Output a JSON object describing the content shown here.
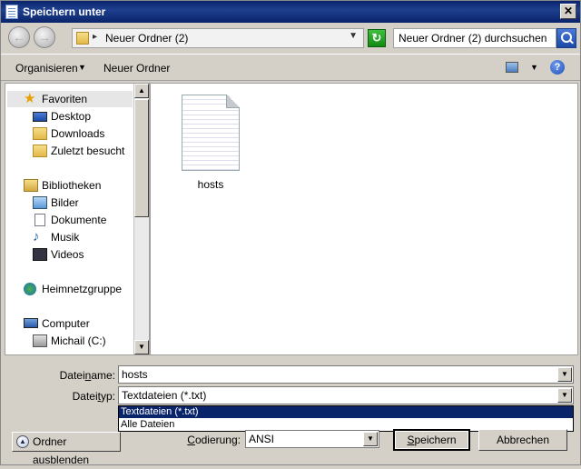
{
  "window": {
    "title": "Speichern unter",
    "close_symbol": "✕"
  },
  "nav": {
    "back_symbol": "←",
    "forward_symbol": "→",
    "address_path": "Neuer Ordner (2)",
    "refresh_symbol": "↻",
    "search_placeholder": "Neuer Ordner (2) durchsuchen"
  },
  "toolbar": {
    "organize_label": "Organisieren",
    "new_folder_label": "Neuer Ordner",
    "help_symbol": "?"
  },
  "sidebar": {
    "items": [
      {
        "label": "Favoriten",
        "icon": "star-icon"
      },
      {
        "label": "Desktop",
        "icon": "desktop-icon"
      },
      {
        "label": "Downloads",
        "icon": "downloads-folder-icon"
      },
      {
        "label": "Zuletzt besucht",
        "icon": "recent-places-icon"
      },
      {
        "label": "Bibliotheken",
        "icon": "libraries-icon"
      },
      {
        "label": "Bilder",
        "icon": "pictures-icon"
      },
      {
        "label": "Dokumente",
        "icon": "documents-icon"
      },
      {
        "label": "Musik",
        "icon": "music-icon"
      },
      {
        "label": "Videos",
        "icon": "videos-icon"
      },
      {
        "label": "Heimnetzgruppe",
        "icon": "homegroup-icon"
      },
      {
        "label": "Computer",
        "icon": "computer-icon"
      },
      {
        "label": "Michail (C:)",
        "icon": "drive-icon"
      }
    ]
  },
  "files": [
    {
      "name": "hosts",
      "icon": "text-file-icon"
    }
  ],
  "form": {
    "filename_label_pre": "Datei",
    "filename_label_u": "n",
    "filename_label_post": "ame:",
    "filename_value": "hosts",
    "filetype_label_pre": "Datei",
    "filetype_label_u": "t",
    "filetype_label_post": "yp:",
    "filetype_value": "Textdateien (*.txt)",
    "filetype_options": [
      "Textdateien (*.txt)",
      "Alle Dateien"
    ],
    "encoding_label_u": "C",
    "encoding_label_post": "odierung:",
    "encoding_value": "ANSI"
  },
  "buttons": {
    "hide_folders": "Ordner ausblenden",
    "save_u": "S",
    "save_post": "peichern",
    "cancel": "Abbrechen"
  }
}
